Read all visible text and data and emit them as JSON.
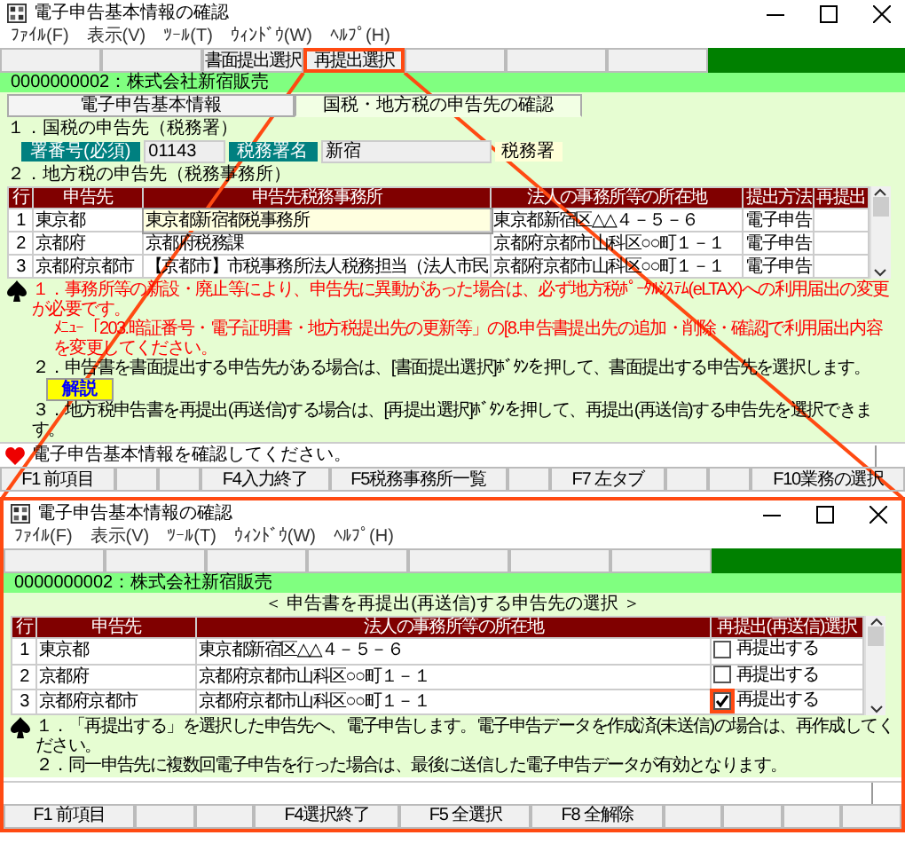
{
  "top_window": {
    "title": "電子申告基本情報の確認",
    "menu": [
      "ﾌｧｲﾙ(F)",
      "表示(V)",
      "ﾂｰﾙ(T)",
      "ｳｨﾝﾄﾞｳ(W)",
      "ﾍﾙﾌﾟ(H)"
    ],
    "toolbar": [
      {
        "highlighted": false
      },
      {
        "highlighted": false
      },
      {
        "label": "書面提出選択",
        "highlighted": false
      },
      {
        "label": "再提出選択",
        "highlighted": true
      },
      {
        "highlighted": false
      },
      {
        "highlighted": false
      },
      {
        "highlighted": false
      }
    ],
    "company": "0000000002：株式会社新宿販売",
    "tabs": [
      {
        "label": "電子申告基本情報",
        "selected": false
      },
      {
        "label": "国税・地方税の申告先の確認",
        "selected": true
      }
    ],
    "national_tax": {
      "heading": "１．国税の申告先（税務署）",
      "office_no_label": "署番号(必須)",
      "office_no": "01143",
      "office_name_label": "税務署名",
      "office_name": "新宿",
      "office_suffix": "税務署"
    },
    "local_tax": {
      "heading": "２．地方税の申告先（税務事務所）",
      "columns": [
        "行",
        "申告先",
        "申告先税務事務所",
        "法人の事務所等の所在地",
        "提出方法",
        "再提出"
      ],
      "rows": [
        {
          "row": "1",
          "name": "東京都",
          "office": "東京都新宿都税事務所",
          "address": "東京都新宿区△△４－５－６",
          "method": "電子申告",
          "focused": true
        },
        {
          "row": "2",
          "name": "京都府",
          "office": "京都府税務課",
          "address": "京都府京都市山科区○○町１－１",
          "method": "電子申告",
          "focused": false
        },
        {
          "row": "3",
          "name": "京都府京都市",
          "office": "【京都市】市税事務所法人税務担当（法人市民",
          "address": "京都府京都市山科区○○町１－１",
          "method": "電子申告",
          "focused": false
        }
      ]
    },
    "notes": [
      {
        "kind": "warning",
        "lines": [
          "１．事務所等の新設・廃止等により、申告先に異動があった場合は、必ず地方税ﾎﾟｰﾀﾙｼｽﾃﾑ(eLTAX)への利用届出の変更が必要です。",
          "ﾒﾆｭｰ「203.暗証番号・電子証明書・地方税提出先の更新等」の[8.申告書提出先の追加・削除・確認]で利用届出内容を変更してください。"
        ]
      },
      {
        "kind": "info",
        "lines": [
          "２．申告書を書面提出する申告先がある場合は、[書面提出選択]ﾎﾞﾀﾝを押して、書面提出する申告先を選択します。"
        ],
        "button": "解説"
      },
      {
        "kind": "info",
        "lines": [
          "３．地方税申告書を再提出(再送信)する場合は、[再提出選択]ﾎﾞﾀﾝを押して、再提出(再送信)する申告先を選択できます。"
        ]
      }
    ],
    "status": "電子申告基本情報を確認してください。",
    "function_keys": [
      {
        "kind": "key",
        "label": "F1 前項目"
      },
      {
        "kind": "blank"
      },
      {
        "kind": "blank"
      },
      {
        "kind": "key",
        "label": "F4入力終了"
      },
      {
        "kind": "key",
        "label": "F5税務事務所一覧"
      },
      {
        "kind": "blank"
      },
      {
        "kind": "key",
        "label": "F7 左タブ"
      },
      {
        "kind": "blank"
      },
      {
        "kind": "blank"
      },
      {
        "kind": "key",
        "label": "F10業務の選択"
      }
    ]
  },
  "bottom_window": {
    "title": "電子申告基本情報の確認",
    "menu": [
      "ﾌｧｲﾙ(F)",
      "表示(V)",
      "ﾂｰﾙ(T)",
      "ｳｨﾝﾄﾞｳ(W)",
      "ﾍﾙﾌﾟ(H)"
    ],
    "toolbar": [
      {
        "highlighted": false
      },
      {
        "highlighted": false
      },
      {
        "highlighted": false
      },
      {
        "highlighted": false
      },
      {
        "highlighted": false
      },
      {
        "highlighted": false
      },
      {
        "highlighted": false
      }
    ],
    "company": "0000000002：株式会社新宿販売",
    "heading": "＜ 申告書を再提出(再送信)する申告先の選択 ＞",
    "columns": [
      "行",
      "申告先",
      "法人の事務所等の所在地",
      "再提出(再送信)選択"
    ],
    "rows": [
      {
        "row": "1",
        "name": "東京都",
        "address": "東京都新宿区△△４－５－６",
        "option": "再提出する",
        "checked": false,
        "highlighted": false
      },
      {
        "row": "2",
        "name": "京都府",
        "address": "京都府京都市山科区○○町１－１",
        "option": "再提出する",
        "checked": false,
        "highlighted": false
      },
      {
        "row": "3",
        "name": "京都府京都市",
        "address": "京都府京都市山科区○○町１－１",
        "option": "再提出する",
        "checked": true,
        "highlighted": true
      }
    ],
    "notes": [
      {
        "lines": [
          "１．「再提出する」を選択した申告先へ、電子申告します。電子申告データを作成済(未送信)の場合は、再作成してください。",
          "２．同一申告先に複数回電子申告を行った場合は、最後に送信した電子申告データが有効となります。"
        ]
      }
    ],
    "function_keys": [
      {
        "kind": "key",
        "label": "F1 前項目"
      },
      {
        "kind": "blank"
      },
      {
        "kind": "blank"
      },
      {
        "kind": "key",
        "label": "F4選択終了"
      },
      {
        "kind": "key",
        "label": "F5 全選択"
      },
      {
        "kind": "key",
        "label": "F8 全解除"
      },
      {
        "kind": "blank"
      },
      {
        "kind": "blank"
      },
      {
        "kind": "blank"
      },
      {
        "kind": "blank"
      }
    ]
  }
}
